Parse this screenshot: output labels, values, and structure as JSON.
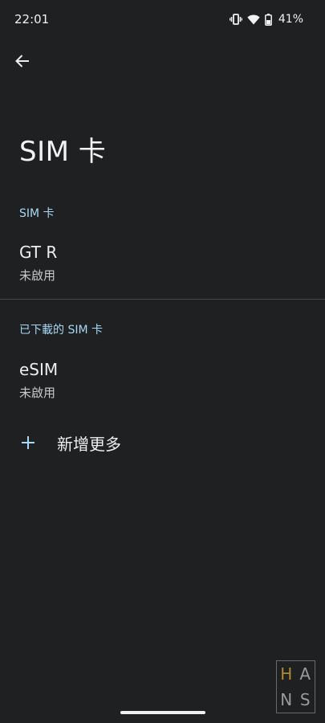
{
  "status_bar": {
    "time": "22:01",
    "battery_percent": "41%",
    "icons": [
      "vibrate-icon",
      "wifi-icon",
      "battery-icon"
    ]
  },
  "toolbar": {
    "back_icon": "arrow-left-icon"
  },
  "page": {
    "title": "SIM 卡"
  },
  "sections": [
    {
      "header": "SIM 卡",
      "items": [
        {
          "title": "GT R",
          "subtitle": "未啟用"
        }
      ]
    },
    {
      "header": "已下載的 SIM 卡",
      "items": [
        {
          "title": "eSIM",
          "subtitle": "未啟用"
        }
      ]
    }
  ],
  "add_more": {
    "icon": "plus-icon",
    "label": "新增更多"
  },
  "watermark": {
    "letters": [
      "H",
      "A",
      "N",
      "S"
    ]
  },
  "colors": {
    "background": "#1f2021",
    "section_header": "#a8d8f5",
    "accent_plus": "#a8d8f5",
    "divider": "#45474a"
  }
}
